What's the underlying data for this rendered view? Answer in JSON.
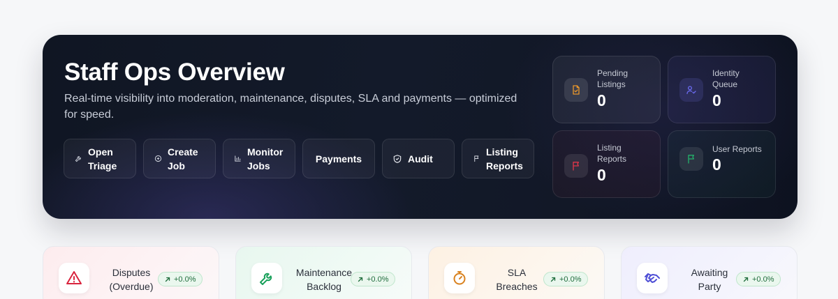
{
  "hero": {
    "title": "Staff Ops Overview",
    "subtitle": "Real-time visibility into moderation, maintenance, disputes, SLA and payments — optimized for speed.",
    "actions": [
      {
        "label_1": "Open",
        "label_2": "Triage",
        "icon": "wrench-icon"
      },
      {
        "label_1": "Create",
        "label_2": "Job",
        "icon": "plus-circle-icon"
      },
      {
        "label_1": "Monitor",
        "label_2": "Jobs",
        "icon": "bar-chart-icon"
      },
      {
        "label": "Payments"
      },
      {
        "label": "Audit",
        "icon": "shield-icon"
      },
      {
        "label_1": "Listing",
        "label_2": "Reports",
        "icon": "flag-icon"
      }
    ]
  },
  "stats": [
    {
      "label_1": "Pending",
      "label_2": "Listings",
      "value": "0",
      "icon": "file-check-icon",
      "color": "#e8962b"
    },
    {
      "label_1": "Identity",
      "label_2": "Queue",
      "value": "0",
      "icon": "user-check-icon",
      "color": "#6b6bf0"
    },
    {
      "label_1": "Listing",
      "label_2": "Reports",
      "value": "0",
      "icon": "flag-icon",
      "color": "#e0364a"
    },
    {
      "label": "User Reports",
      "value": "0",
      "icon": "flag-icon",
      "color": "#24b06a"
    }
  ],
  "kpis": [
    {
      "label_1": "Disputes",
      "label_2": "(Overdue)",
      "delta": "+0.0%",
      "icon": "warning-triangle-icon",
      "color": "#d9243e"
    },
    {
      "label_1": "Maintenance",
      "label_2": "Backlog",
      "delta": "+0.0%",
      "icon": "wrench-icon",
      "color": "#18a05a"
    },
    {
      "label_1": "SLA",
      "label_2": "Breaches",
      "delta": "+0.0%",
      "icon": "stopwatch-icon",
      "color": "#d9821f"
    },
    {
      "label_1": "Awaiting",
      "label_2": "Party",
      "delta": "+0.0%",
      "icon": "handshake-icon",
      "color": "#4f4fd6"
    }
  ],
  "colors": {
    "badge_text": "#1f6d3c",
    "badge_bg": "#eaf7ee"
  }
}
